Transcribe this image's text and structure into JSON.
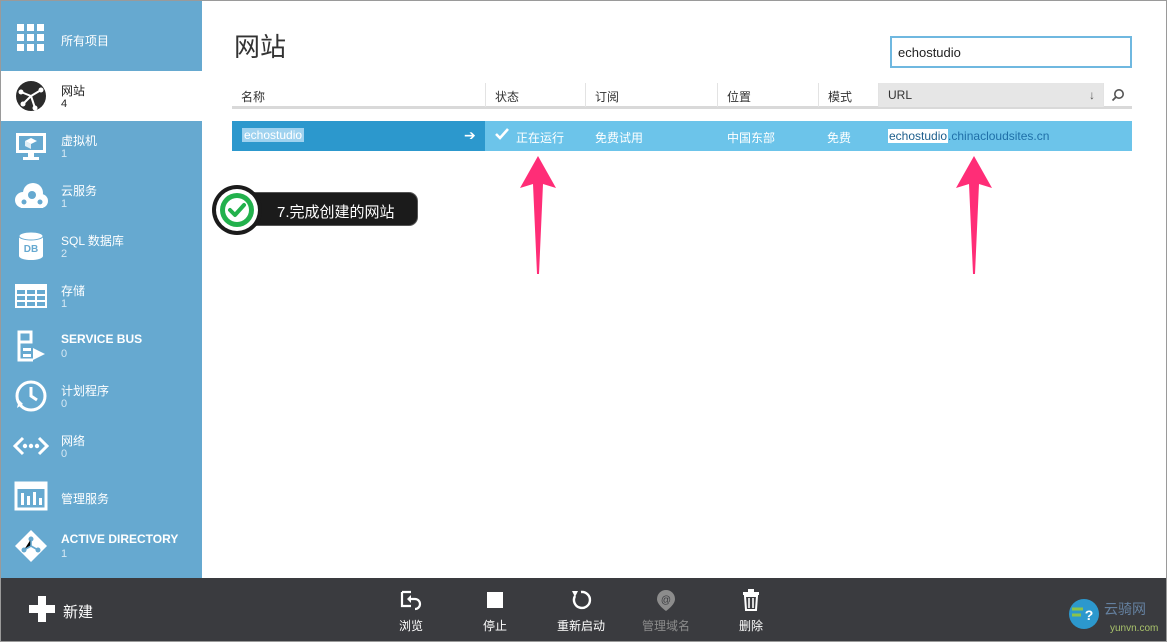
{
  "sidebar": {
    "items": [
      {
        "label": "所有项目",
        "count": "",
        "icon": "grid-icon"
      },
      {
        "label": "网站",
        "count": "4",
        "icon": "website-icon"
      },
      {
        "label": "虚拟机",
        "count": "1",
        "icon": "virtual-machine-icon"
      },
      {
        "label": "云服务",
        "count": "1",
        "icon": "cloud-service-icon"
      },
      {
        "label": "SQL 数据库",
        "count": "2",
        "icon": "database-icon"
      },
      {
        "label": "存储",
        "count": "1",
        "icon": "storage-icon"
      },
      {
        "label": "SERVICE BUS",
        "count": "0",
        "icon": "service-bus-icon"
      },
      {
        "label": "计划程序",
        "count": "0",
        "icon": "scheduler-icon"
      },
      {
        "label": "网络",
        "count": "0",
        "icon": "network-icon"
      },
      {
        "label": "管理服务",
        "count": "",
        "icon": "management-services-icon"
      },
      {
        "label": "ACTIVE DIRECTORY",
        "count": "1",
        "icon": "active-directory-icon"
      }
    ],
    "db_icon_text": "DB"
  },
  "main": {
    "title": "网站",
    "search": {
      "value": "echostudio"
    },
    "columns": [
      "名称",
      "状态",
      "订阅",
      "位置",
      "模式",
      "URL"
    ],
    "rows": [
      {
        "name": "echostudio",
        "status": "正在运行",
        "subscription": "免费试用",
        "location": "中国东部",
        "mode": "免费",
        "url_host": "echostudio",
        "url_domain": ".chinacloudsites.cn"
      }
    ]
  },
  "annotation": {
    "text": "7.完成创建的网站"
  },
  "bottom_bar": {
    "new_label": "新建",
    "commands": [
      {
        "label": "浏览",
        "icon": "browse-icon",
        "enabled": true
      },
      {
        "label": "停止",
        "icon": "stop-icon",
        "enabled": true
      },
      {
        "label": "重新启动",
        "icon": "restart-icon",
        "enabled": true
      },
      {
        "label": "管理域名",
        "icon": "manage-domains-icon",
        "enabled": false
      },
      {
        "label": "删除",
        "icon": "delete-icon",
        "enabled": true
      }
    ]
  },
  "watermark": {
    "text": "云骑网",
    "url": "yunvn.com"
  },
  "colors": {
    "sidebar": "#66a9d0",
    "row_selected": "#6cc4ea",
    "row_name_cell": "#2c98cd",
    "bottom_bar": "#3a3b3f",
    "annotation_arrow": "#ff2d77",
    "annotation_check": "#22b14c"
  }
}
